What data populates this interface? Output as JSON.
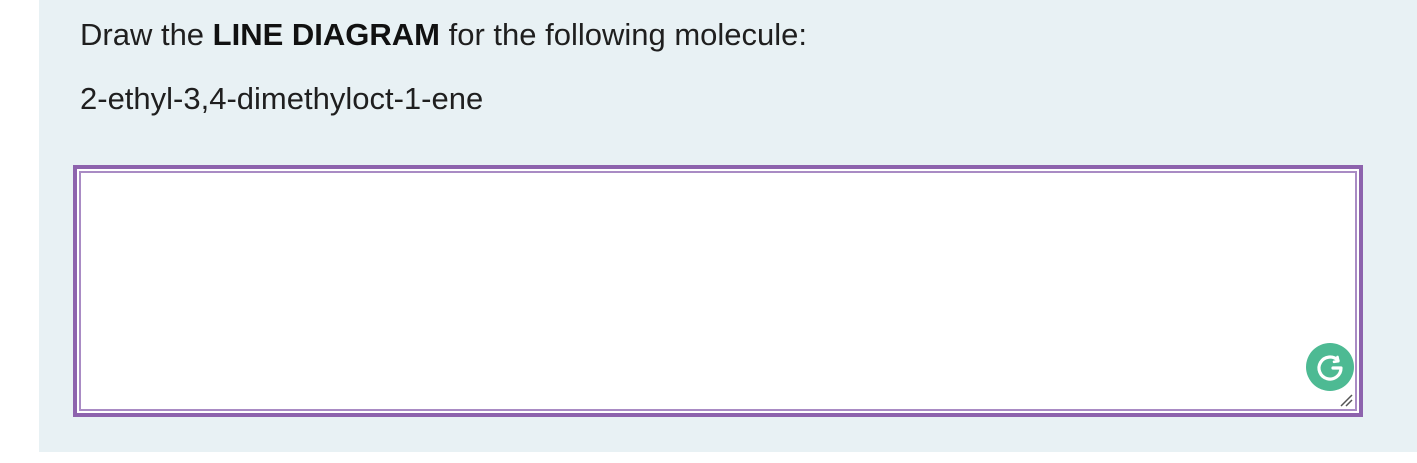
{
  "question": {
    "prompt_before": "Draw the ",
    "prompt_emphasis": "LINE DIAGRAM",
    "prompt_after": " for the following molecule:",
    "molecule": "2-ethyl-3,4-dimethyloct-1-ene"
  },
  "answer": {
    "value": "",
    "placeholder": ""
  },
  "icons": {
    "grammarly": "grammarly-icon",
    "resize": "resize-handle-icon"
  },
  "colors": {
    "panel_background": "#e8f1f4",
    "answer_border": "#8d63ad",
    "grammarly_badge": "#4dba93"
  }
}
